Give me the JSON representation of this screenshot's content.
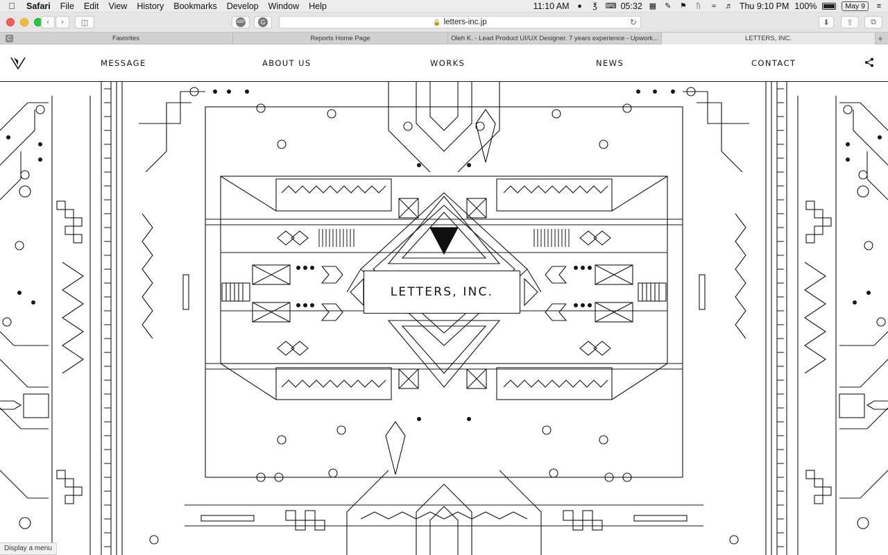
{
  "menubar": {
    "app": "Safari",
    "items": [
      "File",
      "Edit",
      "View",
      "History",
      "Bookmarks",
      "Develop",
      "Window",
      "Help"
    ],
    "clock_left": "11:10 AM",
    "timer": "05:32",
    "datetime": "Thu 9:10 PM",
    "battery": "100%",
    "date_badge": "May 9"
  },
  "toolbar": {
    "url": "letters-inc.jp",
    "abp_label": "ABP",
    "g_label": "G"
  },
  "tabs": [
    {
      "label": "Favorites"
    },
    {
      "label": "Reports Home Page"
    },
    {
      "label": "Oleh K. - Lead Product UI/UX Designer. 7 years experience - Upwork..."
    },
    {
      "label": "LETTERS, INC."
    }
  ],
  "tab_icon_label": "C",
  "nav": {
    "links": [
      "MESSAGE",
      "ABOUT US",
      "WORKS",
      "NEWS",
      "CONTACT"
    ]
  },
  "hero": {
    "title": "LETTERS, INC."
  },
  "status": {
    "text": "Display a menu"
  },
  "colors": {
    "ink": "#111111",
    "background": "#ffffff",
    "menubar": "#ececec",
    "toolbar": "#e5e5e5"
  }
}
